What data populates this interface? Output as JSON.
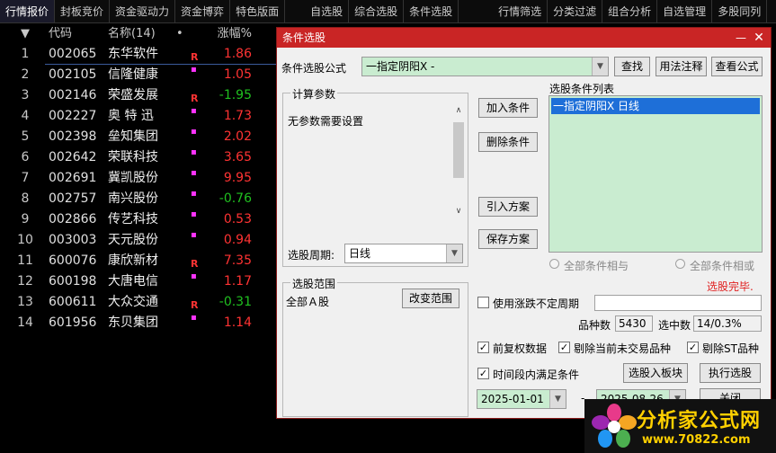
{
  "topbar": {
    "tabs": [
      "行情报价",
      "封板竞价",
      "资金驱动力",
      "资金博弈",
      "特色版面",
      "自选股",
      "综合选股",
      "条件选股",
      "行情筛选",
      "分类过滤",
      "组合分析",
      "自选管理",
      "多股同列"
    ]
  },
  "grid": {
    "headers": {
      "code": "代码",
      "name": "名称(14)",
      "dot": "•",
      "pct": "涨幅%"
    },
    "rows": [
      {
        "idx": "1",
        "code": "002065",
        "name": "东华软件",
        "flag": "R",
        "pct": "1.86",
        "dir": "up"
      },
      {
        "idx": "2",
        "code": "002105",
        "name": "信隆健康",
        "flag": "",
        "pct": "1.05",
        "dir": "up"
      },
      {
        "idx": "3",
        "code": "002146",
        "name": "荣盛发展",
        "flag": "R",
        "pct": "-1.95",
        "dir": "down"
      },
      {
        "idx": "4",
        "code": "002227",
        "name": "奥 特 迅",
        "flag": "",
        "pct": "1.73",
        "dir": "up"
      },
      {
        "idx": "5",
        "code": "002398",
        "name": "垒知集团",
        "flag": "",
        "pct": "2.02",
        "dir": "up"
      },
      {
        "idx": "6",
        "code": "002642",
        "name": "荣联科技",
        "flag": "",
        "pct": "3.65",
        "dir": "up"
      },
      {
        "idx": "7",
        "code": "002691",
        "name": "冀凯股份",
        "flag": "",
        "pct": "9.95",
        "dir": "up"
      },
      {
        "idx": "8",
        "code": "002757",
        "name": "南兴股份",
        "flag": "",
        "pct": "-0.76",
        "dir": "down"
      },
      {
        "idx": "9",
        "code": "002866",
        "name": "传艺科技",
        "flag": "",
        "pct": "0.53",
        "dir": "up"
      },
      {
        "idx": "10",
        "code": "003003",
        "name": "天元股份",
        "flag": "",
        "pct": "0.94",
        "dir": "up"
      },
      {
        "idx": "11",
        "code": "600076",
        "name": "康欣新材",
        "flag": "R",
        "pct": "7.35",
        "dir": "up"
      },
      {
        "idx": "12",
        "code": "600198",
        "name": "大唐电信",
        "flag": "",
        "pct": "1.17",
        "dir": "up"
      },
      {
        "idx": "13",
        "code": "600611",
        "name": "大众交通",
        "flag": "R",
        "pct": "-0.31",
        "dir": "down"
      },
      {
        "idx": "14",
        "code": "601956",
        "name": "东贝集团",
        "flag": "",
        "pct": "1.14",
        "dir": "up"
      }
    ]
  },
  "dialog": {
    "title": "条件选股",
    "formula_label": "条件选股公式",
    "formula_value": "一指定阴阳X  -",
    "btn_find": "查找",
    "btn_usage": "用法注释",
    "btn_view": "查看公式",
    "params_group": "计算参数",
    "params_text": "无参数需要设置",
    "period_label": "选股周期:",
    "period_value": "日线",
    "btn_add": "加入条件",
    "btn_delete": "删除条件",
    "btn_import": "引入方案",
    "btn_save": "保存方案",
    "cond_list_label": "选股条件列表",
    "cond_item": "一指定阴阳X  日线",
    "radio_and": "全部条件相与",
    "radio_or": "全部条件相或",
    "status": "选股完毕.",
    "range_group": "选股范围",
    "range_value": "全部Ａ股",
    "btn_range": "改变范围",
    "use_period_label": "使用涨跌不定周期",
    "count_label": "品种数",
    "count_value": "5430",
    "selected_label": "选中数",
    "selected_value": "14/0.3%",
    "chk_fq": "前复权数据",
    "chk_notrade": "剔除当前未交易品种",
    "chk_st": "剔除ST品种",
    "chk_time": "时间段内满足条件",
    "btn_block": "选股入板块",
    "btn_run": "执行选股",
    "date_from": "2025-01-01",
    "date_sep": "-",
    "date_to": "2025-08-26",
    "btn_close": "关闭"
  },
  "logo": {
    "text": "分析家公式网",
    "url": "www.70822.com"
  },
  "colors": {
    "up": "#ff3333",
    "down": "#20c020",
    "title_bar": "#c92525",
    "selected": "#1e6fd8"
  }
}
